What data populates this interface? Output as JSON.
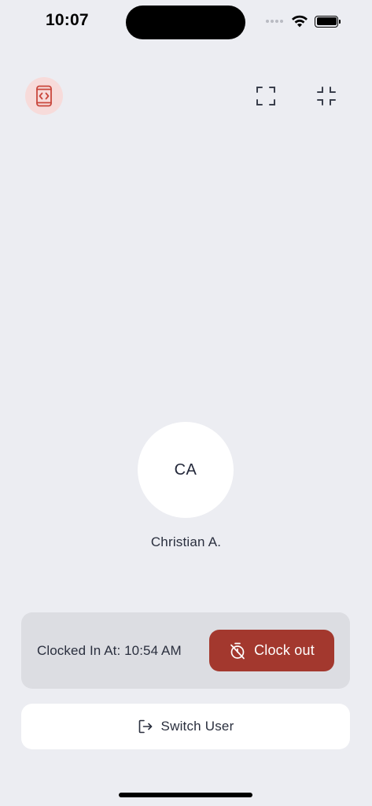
{
  "status_bar": {
    "time": "10:07",
    "icons": [
      "signal-icon",
      "wifi-icon",
      "battery-icon"
    ]
  },
  "toolbar": {
    "left_icon": "mobile-code-icon",
    "right_icons": [
      "expand-icon",
      "shrink-icon"
    ]
  },
  "user": {
    "initials": "CA",
    "name": "Christian A."
  },
  "clock_card": {
    "clocked_in_text": "Clocked In At: 10:54 AM",
    "clock_out_label": "Clock out",
    "clock_out_icon": "timer-off-icon"
  },
  "switch_user": {
    "label": "Switch User",
    "icon": "logout-icon"
  },
  "colors": {
    "background": "#ECEDF2",
    "accent": "#A3382E",
    "accent_soft": "#F7DBDA",
    "card": "#DCDDE2",
    "text": "#2A2F3E"
  }
}
